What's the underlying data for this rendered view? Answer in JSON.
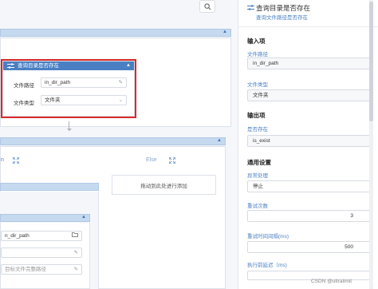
{
  "canvas": {
    "top_bar_caret": "▲",
    "selected_block": {
      "title": "查询目录是否存在",
      "caret": "▲",
      "rows": [
        {
          "label": "文件路径",
          "value": "in_dir_path",
          "tail_icon": "edit-icon"
        },
        {
          "label": "文件类型",
          "value": "文件夹",
          "tail_icon": "chevron-down-icon"
        }
      ]
    },
    "branch": {
      "caret": "▲",
      "left_link": "n",
      "else_label": "Else",
      "dropzone_text": "拖动到此处进行添加"
    },
    "inner_block": {
      "caret": "▲",
      "rows": [
        {
          "value": "n_dir_path",
          "tail_icon": "folder-icon"
        },
        {
          "value": "",
          "tail_icon": "edit-icon"
        },
        {
          "value": "目标文件完整路径",
          "tail_icon": "edit-icon"
        }
      ]
    }
  },
  "panel": {
    "title": "查询目录是否存在",
    "subtitle": "查询文件路径是否存在",
    "input_section": "输入项",
    "field_path_label": "文件路径",
    "field_path_value": "in_dir_path",
    "field_type_label": "文件类型",
    "field_type_value": "文件夹",
    "output_section": "输出项",
    "field_exists_label": "是否存在",
    "field_exists_value": "is_exist",
    "general_section": "通用设置",
    "field_exception_label": "异常处理",
    "field_exception_value": "停止",
    "field_retry_label": "重试次数",
    "field_retry_value": "3",
    "field_interval_label": "重试时间间隔(ms)",
    "field_interval_value": "500",
    "field_delay_label": "执行前延迟（ms)",
    "field_delay_value": ""
  },
  "watermark": "CSDN @ultralimit",
  "colors": {
    "accent": "#4a7fc3",
    "selection": "#d62a2a",
    "bar": "#c5d9ef"
  }
}
